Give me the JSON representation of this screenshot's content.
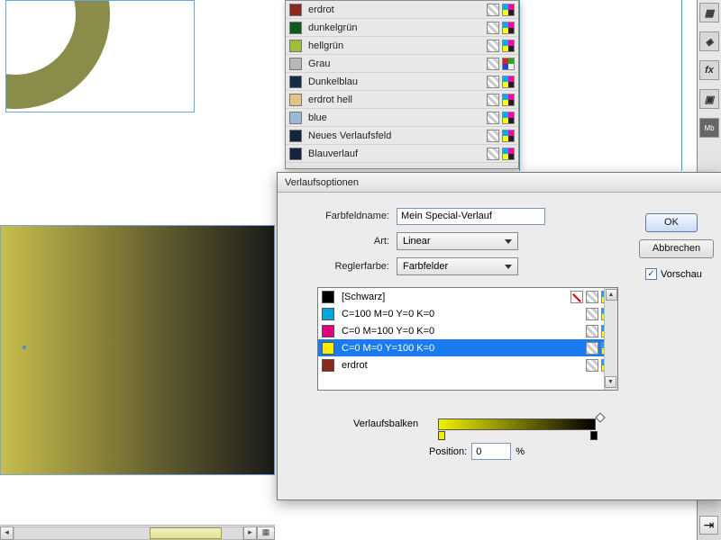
{
  "swatches": {
    "items": [
      {
        "name": "erdrot",
        "color": "#8a2a1e"
      },
      {
        "name": "dunkelgrün",
        "color": "#0b5a24"
      },
      {
        "name": "hellgrün",
        "color": "#9fbd39"
      },
      {
        "name": "Grau",
        "color": "#b7b7b7"
      },
      {
        "name": "Dunkelblau",
        "color": "#162a49"
      },
      {
        "name": "erdrot hell",
        "color": "#e3c28a"
      },
      {
        "name": "blue",
        "color": "#9abad7"
      },
      {
        "name": "Neues Verlaufsfeld",
        "color": "#14243d"
      },
      {
        "name": "Blauverlauf",
        "color": "#14243d"
      }
    ]
  },
  "dialog": {
    "title": "Verlaufsoptionen",
    "field_name_label": "Farbfeldname:",
    "field_name_value": "Mein Special-Verlauf",
    "type_label": "Art:",
    "type_value": "Linear",
    "stop_color_label": "Reglerfarbe:",
    "stop_color_value": "Farbfelder",
    "colors": [
      {
        "name": "[Schwarz]",
        "color": "#000000",
        "noedit": true
      },
      {
        "name": "C=100 M=0 Y=0 K=0",
        "color": "#00a6e0"
      },
      {
        "name": "C=0 M=100 Y=0 K=0",
        "color": "#e20079"
      },
      {
        "name": "C=0 M=0 Y=100 K=0",
        "color": "#f7ee00",
        "selected": true
      },
      {
        "name": "erdrot",
        "color": "#8a2a1e"
      }
    ],
    "ramp_label": "Verlaufsbalken",
    "position_label": "Position:",
    "position_value": "0",
    "position_unit": "%",
    "ok": "OK",
    "cancel": "Abbrechen",
    "preview": "Vorschau"
  },
  "tool_icons": [
    "swatch-icon",
    "layers-icon",
    "fx-icon",
    "styles-icon",
    "mb-icon"
  ],
  "tool_fx": "fx",
  "tool_mb": "Mb"
}
